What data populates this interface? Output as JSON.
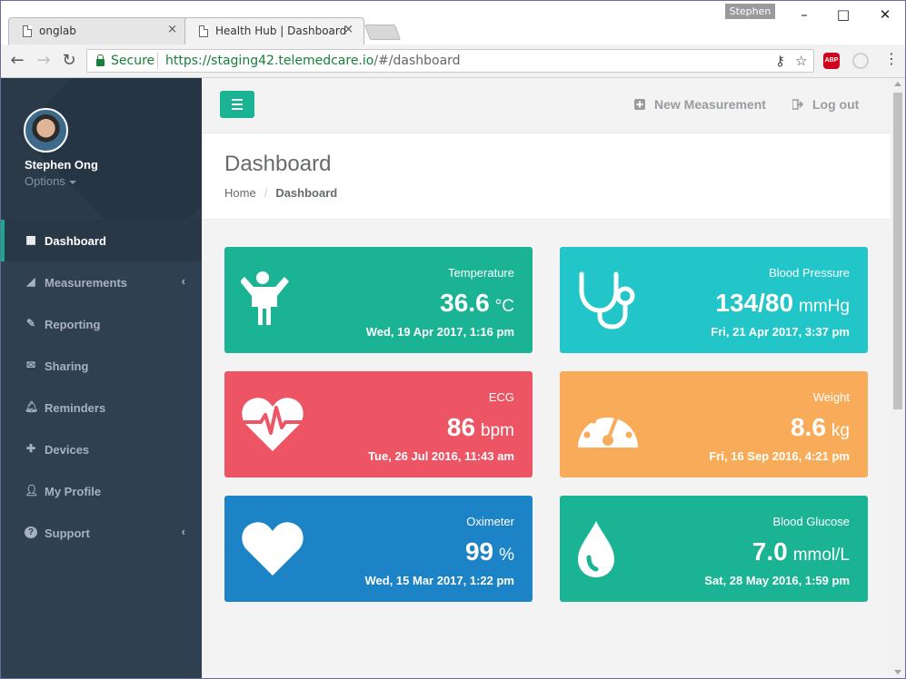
{
  "browser": {
    "tabs": [
      {
        "title": "onglab",
        "close": "×"
      },
      {
        "title": "Health Hub | Dashboard",
        "close": "×"
      }
    ],
    "user": "Stephen",
    "window_controls": {
      "minimize": "–",
      "maximize": "□",
      "close": "✕"
    },
    "nav": {
      "back": "←",
      "forward": "→",
      "reload": "↻"
    },
    "secure_label": "Secure",
    "url_host": "https://staging42.telemedcare.io",
    "url_path": "/#/dashboard",
    "omni_icons": {
      "key": "⚷",
      "star": "☆"
    },
    "extension_abp": "ABP",
    "menu": "⋮"
  },
  "sidebar": {
    "profile": {
      "name": "Stephen Ong",
      "options_label": "Options"
    },
    "items": [
      {
        "label": "Dashboard",
        "icon": "th-large-icon",
        "glyph": "▦",
        "active": true
      },
      {
        "label": "Measurements",
        "icon": "area-chart-icon",
        "glyph": "◢",
        "arrow": "‹"
      },
      {
        "label": "Reporting",
        "icon": "edit-icon",
        "glyph": "✎"
      },
      {
        "label": "Sharing",
        "icon": "envelope-icon",
        "glyph": "✉"
      },
      {
        "label": "Reminders",
        "icon": "bell-icon",
        "glyph": "🔔︎"
      },
      {
        "label": "Devices",
        "icon": "medkit-icon",
        "glyph": "✚"
      },
      {
        "label": "My Profile",
        "icon": "user-icon",
        "glyph": "👤︎"
      },
      {
        "label": "Support",
        "icon": "question-circle-icon",
        "glyph": "?",
        "arrow": "‹"
      }
    ]
  },
  "topnav": {
    "new_measurement": "New Measurement",
    "logout": "Log out"
  },
  "page": {
    "title": "Dashboard",
    "breadcrumb": {
      "home": "Home",
      "separator": "/",
      "current": "Dashboard"
    }
  },
  "cards": [
    {
      "label": "Temperature",
      "value": "36.6",
      "unit": "°C",
      "date": "Wed, 19 Apr 2017, 1:16 pm",
      "color": "#1ab394",
      "icon": "child-icon"
    },
    {
      "label": "Blood Pressure",
      "value": "134/80",
      "unit": "mmHg",
      "date": "Fri, 21 Apr 2017, 3:37 pm",
      "color": "#23c6c8",
      "icon": "stethoscope-icon"
    },
    {
      "label": "ECG",
      "value": "86",
      "unit": "bpm",
      "date": "Tue, 26 Jul 2016, 11:43 am",
      "color": "#ed5565",
      "icon": "heartbeat-icon"
    },
    {
      "label": "Weight",
      "value": "8.6",
      "unit": "kg",
      "date": "Fri, 16 Sep 2016, 4:21 pm",
      "color": "#f8ac59",
      "icon": "dashboard-gauge-icon"
    },
    {
      "label": "Oximeter",
      "value": "99",
      "unit": "%",
      "date": "Wed, 15 Mar 2017, 1:22 pm",
      "color": "#1c84c6",
      "icon": "heart-icon"
    },
    {
      "label": "Blood Glucose",
      "value": "7.0",
      "unit": "mmol/L",
      "date": "Sat, 28 May 2016, 1:59 pm",
      "color": "#1ab394",
      "icon": "tint-drop-icon"
    }
  ]
}
